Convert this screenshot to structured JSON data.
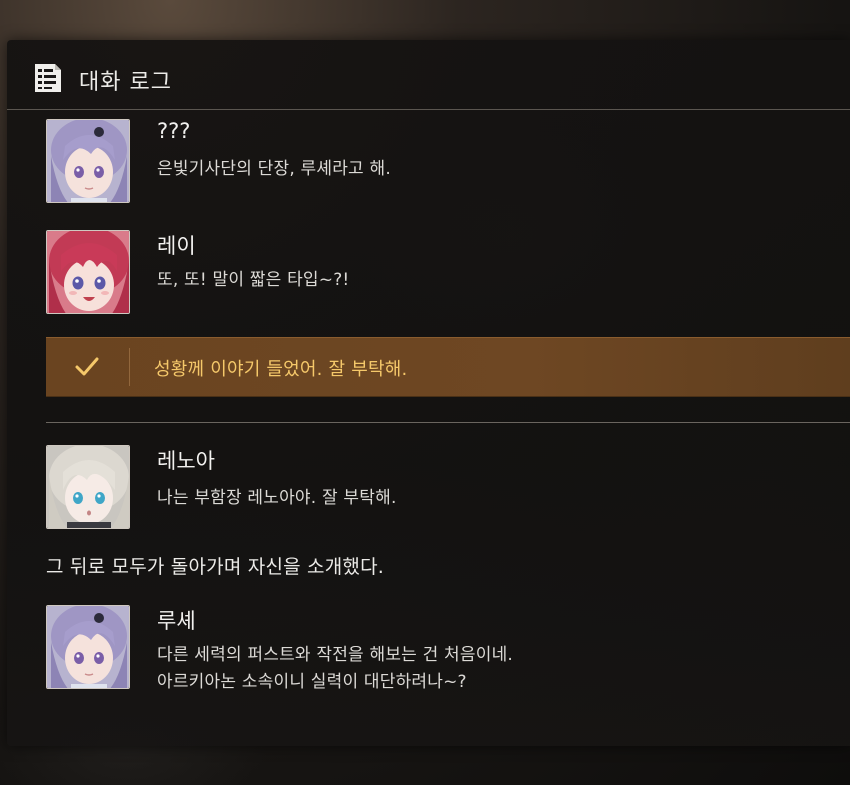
{
  "header": {
    "title": "대화 로그",
    "icon": "log-document-icon"
  },
  "entries": [
    {
      "speaker": "???",
      "lines": [
        "은빛기사단의 단장, 루셰라고 해."
      ],
      "avatar": "lavender-hair-girl-portrait"
    },
    {
      "speaker": "레이",
      "lines": [
        "또, 또! 말이 짧은 타입~?!"
      ],
      "avatar": "red-hair-girl-portrait"
    },
    {
      "speaker": "레노아",
      "lines": [
        "나는 부함장 레노아야. 잘 부탁해."
      ],
      "avatar": "silver-hair-girl-portrait"
    },
    {
      "speaker": "루셰",
      "lines": [
        "다른 세력의 퍼스트와 작전을 해보는 건 처음이네.",
        "아르키아논 소속이니 실력이 대단하려나~?"
      ],
      "avatar": "lavender-hair-girl-portrait"
    }
  ],
  "choice": {
    "text": "성황께 이야기 들었어. 잘 부탁해.",
    "icon": "checkmark-icon",
    "accent": "#f5c86a",
    "background": "#6a4420"
  },
  "narration": "그 뒤로 모두가 돌아가며 자신을 소개했다."
}
